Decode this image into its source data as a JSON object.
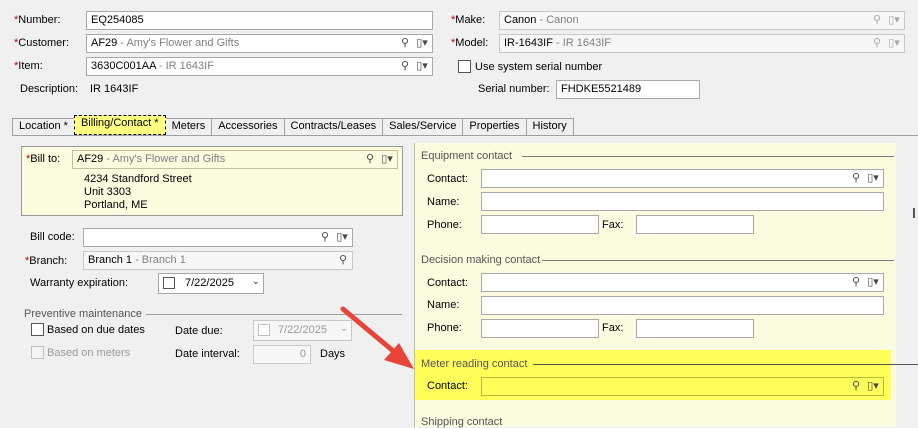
{
  "header": {
    "number_label": "Number:",
    "number_value": "EQ254085",
    "customer_label": "Customer:",
    "customer_code": "AF29",
    "customer_desc": " - Amy's Flower and Gifts",
    "item_label": "Item:",
    "item_code": "3630C001AA",
    "item_desc": " - IR 1643IF",
    "description_label": "Description:",
    "description_value": "IR 1643IF",
    "make_label": "Make:",
    "make_code": "Canon",
    "make_desc": " - Canon",
    "model_label": "Model:",
    "model_code": "IR-1643IF",
    "model_desc": " - IR 1643IF",
    "use_serial_label": "Use system serial number",
    "serial_label": "Serial number:",
    "serial_value": "FHDKE5521489"
  },
  "tabs": [
    {
      "label": "Location *"
    },
    {
      "label": "Billing/Contact *"
    },
    {
      "label": "Meters"
    },
    {
      "label": "Accessories"
    },
    {
      "label": "Contracts/Leases"
    },
    {
      "label": "Sales/Service"
    },
    {
      "label": "Properties"
    },
    {
      "label": "History"
    }
  ],
  "billing": {
    "bill_to_label": "Bill to:",
    "bill_to_code": "AF29",
    "bill_to_desc": " - Amy's Flower and Gifts",
    "address_line1": "4234 Standford Street",
    "address_line2": "Unit 3303",
    "address_line3": "Portland, ME",
    "bill_code_label": "Bill code:",
    "branch_label": "Branch:",
    "branch_code": "Branch 1",
    "branch_desc": " - Branch 1",
    "warranty_label": "Warranty expiration:",
    "warranty_value": "7/22/2025"
  },
  "preventive": {
    "title": "Preventive maintenance",
    "due_dates_label": "Based on due dates",
    "meters_label": "Based on meters",
    "date_due_label": "Date due:",
    "date_due_value": "7/22/2025",
    "date_interval_label": "Date interval:",
    "date_interval_value": "0",
    "days_label": "Days"
  },
  "equipment_contact": {
    "title": "Equipment contact",
    "contact_label": "Contact:",
    "name_label": "Name:",
    "phone_label": "Phone:",
    "fax_label": "Fax:"
  },
  "decision_contact": {
    "title": "Decision making contact",
    "contact_label": "Contact:",
    "name_label": "Name:",
    "phone_label": "Phone:",
    "fax_label": "Fax:"
  },
  "meter_contact": {
    "title": "Meter reading contact",
    "contact_label": "Contact:"
  },
  "shipping_contact": {
    "title": "Shipping contact"
  },
  "colors": {
    "required": "#c00000",
    "highlight": "#ffff5a",
    "arrow": "#e8443a",
    "panel": "#fbfbe0"
  },
  "icons": [
    "search-icon",
    "lookup-dropdown-icon",
    "calendar-icon",
    "chevron-down-icon"
  ]
}
